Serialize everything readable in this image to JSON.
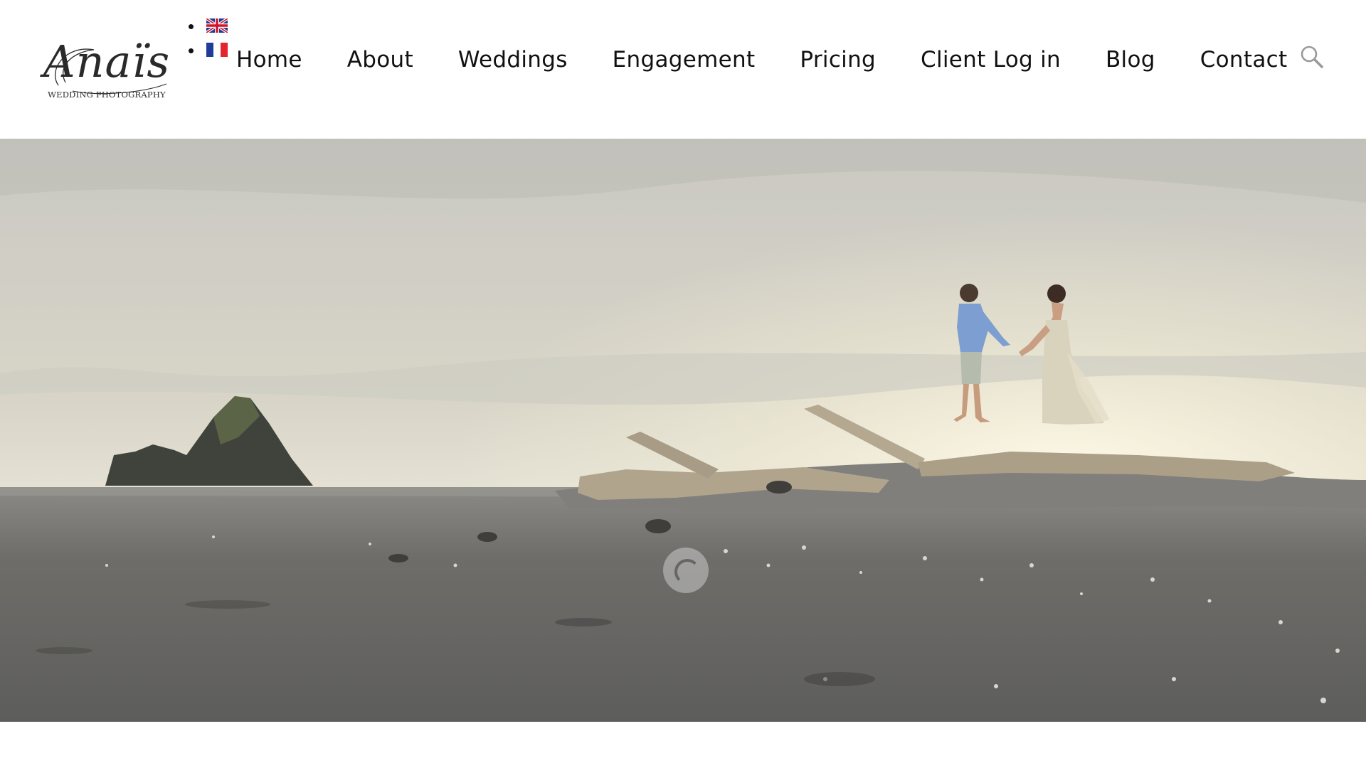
{
  "logo": {
    "script": "Anaïs",
    "subtitle": "WEDDING PHOTOGRAPHY"
  },
  "languages": [
    {
      "code": "en",
      "flag": "uk-flag-icon"
    },
    {
      "code": "fr",
      "flag": "france-flag-icon"
    }
  ],
  "nav": {
    "items": [
      {
        "label": "Home"
      },
      {
        "label": "About"
      },
      {
        "label": "Weddings"
      },
      {
        "label": "Engagement"
      },
      {
        "label": "Pricing"
      },
      {
        "label": "Client Log in"
      },
      {
        "label": "Blog"
      },
      {
        "label": "Contact"
      }
    ]
  },
  "icons": {
    "search": "search-icon",
    "loading": "loading-spinner-icon"
  },
  "colors": {
    "nav_text": "#111111",
    "background": "#ffffff",
    "sky": "#cfcdc6",
    "sand": "#6f6f6c"
  }
}
